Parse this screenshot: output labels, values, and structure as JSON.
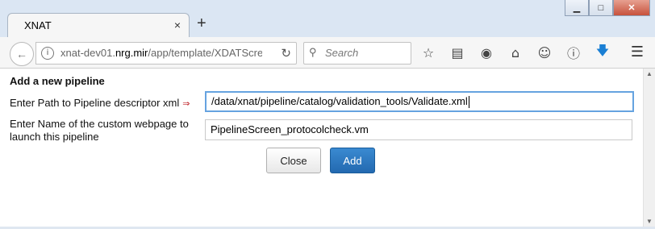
{
  "browser": {
    "tab_title": "XNAT",
    "tab_close": "×",
    "new_tab": "+",
    "url_prefix": "xnat-dev01.",
    "url_domain": "nrg.mir",
    "url_path": "/app/template/XDATScre",
    "search_placeholder": "Search",
    "window_buttons": {
      "minimize": "▁",
      "maximize": "□",
      "close": "✕"
    }
  },
  "page": {
    "title": "Add a new pipeline",
    "path_label": "Enter Path to Pipeline descriptor xml",
    "path_marker": "⇒",
    "path_value": "/data/xnat/pipeline/catalog/validation_tools/Validate.xml",
    "webpage_label": "Enter Name of the custom webpage to launch this pipeline",
    "webpage_value": "PipelineScreen_protocolcheck.vm",
    "close_button": "Close",
    "add_button": "Add"
  }
}
